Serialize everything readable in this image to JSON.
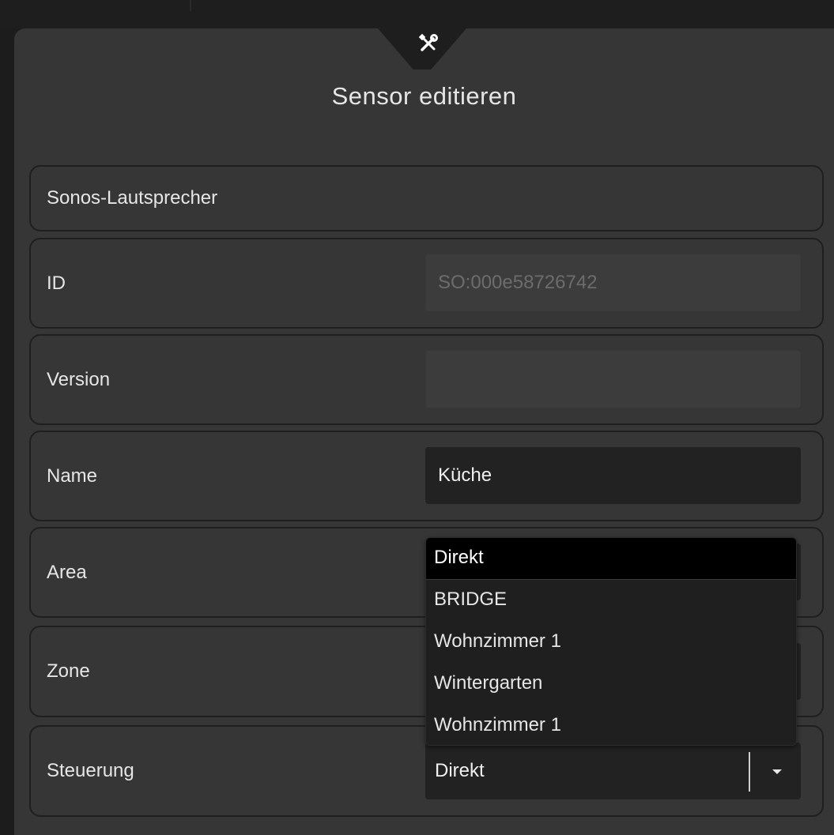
{
  "dialog": {
    "title": "Sensor editieren",
    "section_header": "Sonos-Lautsprecher"
  },
  "rows": {
    "id": {
      "label": "ID",
      "value": "SO:000e58726742"
    },
    "version": {
      "label": "Version",
      "value": ""
    },
    "name": {
      "label": "Name",
      "value": "Küche"
    },
    "area": {
      "label": "Area"
    },
    "zone": {
      "label": "Zone"
    },
    "steuerung": {
      "label": "Steuerung",
      "value": "Direkt"
    }
  },
  "dropdown": {
    "options": [
      "Direkt",
      "BRIDGE",
      "Wohnzimmer 1",
      "Wintergarten",
      "Wohnzimmer 1"
    ],
    "selected_index": 0
  },
  "icons": {
    "header": "tools-icon",
    "select": "caret-down-icon"
  },
  "colors": {
    "background": "#1c1c1c",
    "panel": "#363636",
    "field": "#222222",
    "text": "#e6e6e6"
  }
}
